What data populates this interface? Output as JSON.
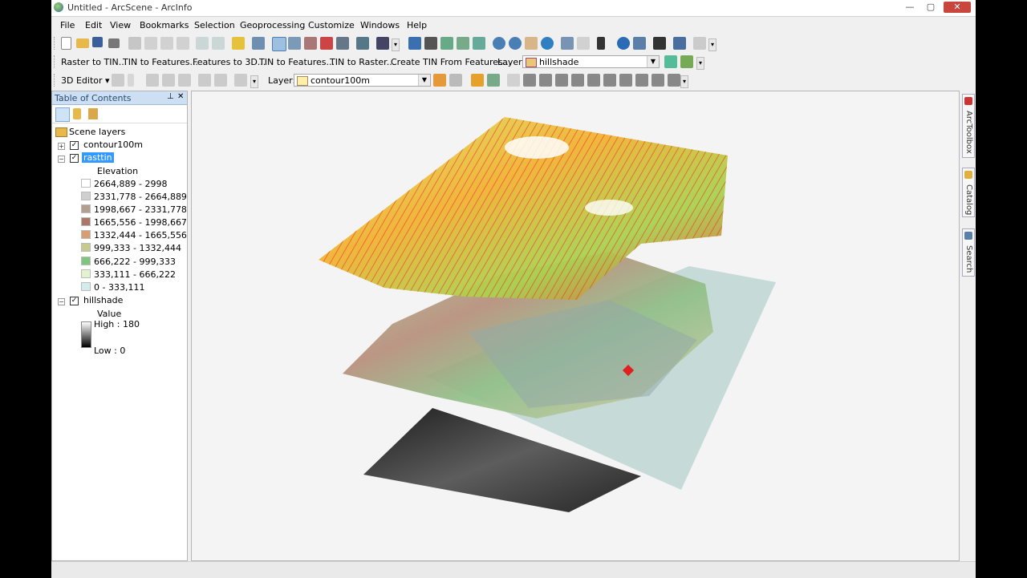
{
  "window": {
    "title": "Untitled - ArcScene - ArcInfo",
    "min": "—",
    "max": "▢",
    "close": "✕"
  },
  "menu": [
    "File",
    "Edit",
    "View",
    "Bookmarks",
    "Selection",
    "Geoprocessing",
    "Customize",
    "Windows",
    "Help"
  ],
  "toolbar3d": {
    "buttons": [
      "Raster to TIN...",
      "TIN to Features...",
      "Features to 3D...",
      "TIN to Features...",
      "TIN to Raster...",
      "Create TIN From Features..."
    ],
    "layer_label": "Layer:",
    "layer_value": "hillshade"
  },
  "editor": {
    "label": "3D Editor",
    "arrow": "▾",
    "layer_label": "Layer:",
    "layer_value": "contour100m"
  },
  "toc": {
    "title": "Table of Contents",
    "pin": "⊥",
    "close": "✕",
    "group": "Scene layers",
    "layers": {
      "contour": "contour100m",
      "rasttin": "rasttin",
      "elevation_label": "Elevation",
      "classes": [
        "2664,889 - 2998",
        "2331,778 - 2664,889",
        "1998,667 - 2331,778",
        "1665,556 - 1998,667",
        "1332,444 - 1665,556",
        "999,333 - 1332,444",
        "666,222 - 999,333",
        "333,111 - 666,222",
        "0 - 333,111"
      ],
      "hillshade": "hillshade",
      "value_label": "Value",
      "high": "High : 180",
      "low": "Low : 0"
    }
  },
  "class_colors": [
    "#ffffff",
    "#cfcfcf",
    "#b39e92",
    "#a9786a",
    "#d99d72",
    "#c7c98e",
    "#7fc47f",
    "#e4f3cf",
    "#d3eded"
  ],
  "dock_tabs": [
    "ArcToolbox",
    "Catalog",
    "Search"
  ]
}
